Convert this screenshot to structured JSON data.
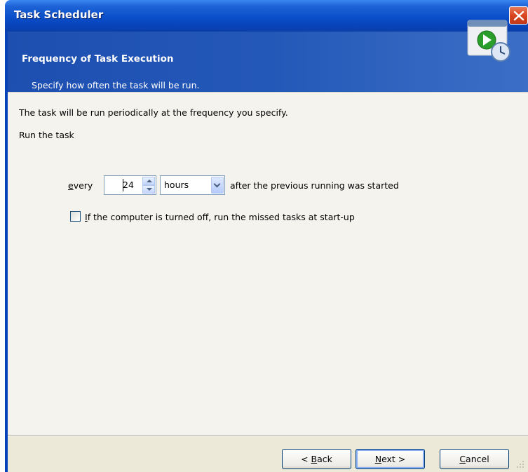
{
  "window": {
    "title": "Task Scheduler"
  },
  "header": {
    "title": "Frequency of Task Execution",
    "subtitle": "Specify how often the task will be run."
  },
  "content": {
    "intro": "The task will be run periodically at the frequency you specify.",
    "run_label": "Run the task",
    "every_label_mnemonic": "e",
    "every_label_rest": "very",
    "interval_value": "24",
    "unit_selected": "hours",
    "after_text": "after the previous running was started",
    "missed_checkbox_mnemonic": "I",
    "missed_checkbox_rest": "f the computer is turned off, run the missed tasks at start-up",
    "missed_checked": false
  },
  "buttons": {
    "back_prefix": "< ",
    "back_mnemonic": "B",
    "back_rest": "ack",
    "next_mnemonic": "N",
    "next_rest": "ext >",
    "cancel_mnemonic": "C",
    "cancel_rest": "ancel"
  },
  "icons": {
    "close": "close-icon",
    "header": "task-schedule-icon",
    "grip": "resize-grip-icon"
  },
  "colors": {
    "title_bar": "#0a4fc9",
    "header_band": "#2458b8",
    "close_button": "#d9461f",
    "content_bg": "#f4f3ee"
  }
}
